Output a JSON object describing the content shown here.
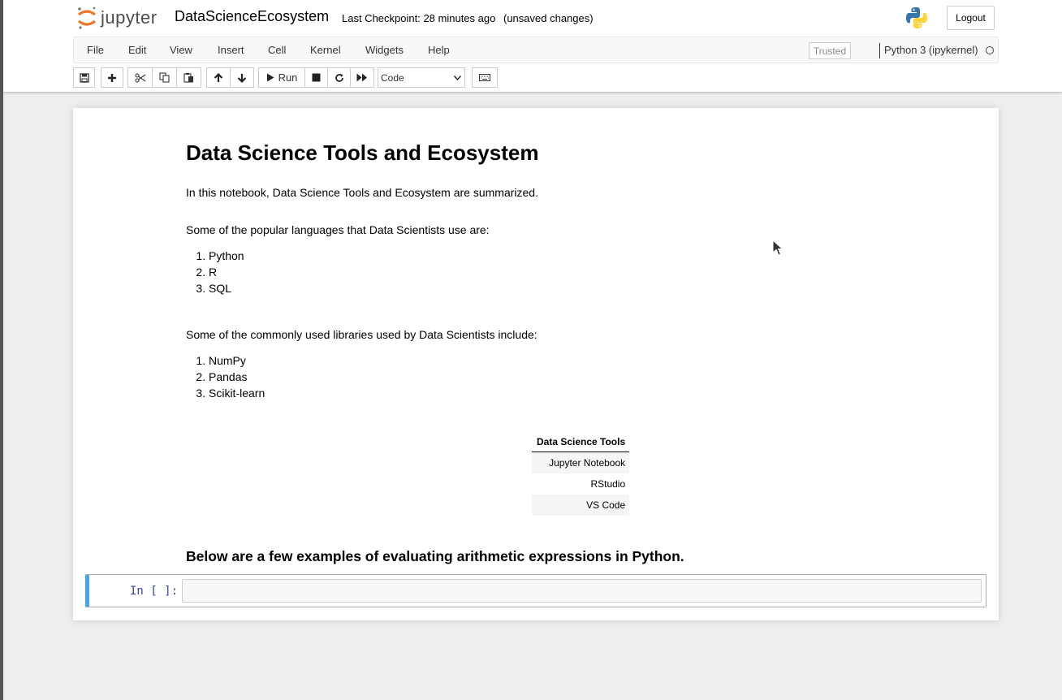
{
  "header": {
    "logo_text": "jupyter",
    "notebook_name": "DataScienceEcosystem",
    "checkpoint": "Last Checkpoint: 28 minutes ago",
    "autosave": "(unsaved changes)",
    "logout_label": "Logout"
  },
  "menubar": {
    "items": [
      "File",
      "Edit",
      "View",
      "Insert",
      "Cell",
      "Kernel",
      "Widgets",
      "Help"
    ],
    "trusted_label": "Trusted",
    "kernel_name": "Python 3 (ipykernel)"
  },
  "toolbar": {
    "run_label": "Run",
    "cell_type": "Code"
  },
  "notebook": {
    "title": "Data Science Tools and Ecosystem",
    "intro": "In this notebook, Data Science Tools and Ecosystem are summarized.",
    "languages_heading": "Some of the popular languages that Data Scientists use are:",
    "languages": [
      "Python",
      "R",
      "SQL"
    ],
    "libraries_heading": "Some of the commonly used libraries used by Data Scientists include:",
    "libraries": [
      "NumPy",
      "Pandas",
      "Scikit-learn"
    ],
    "table": {
      "header": "Data Science Tools",
      "rows": [
        "Jupyter Notebook",
        "RStudio",
        "VS Code"
      ]
    },
    "examples_heading": "Below are a few examples of evaluating arithmetic expressions in Python.",
    "cell_prompt": "In [ ]:"
  },
  "colors": {
    "cell_border_selected": "#42a5f5",
    "prompt": "#303f9f",
    "logo_orange": "#f37626"
  }
}
